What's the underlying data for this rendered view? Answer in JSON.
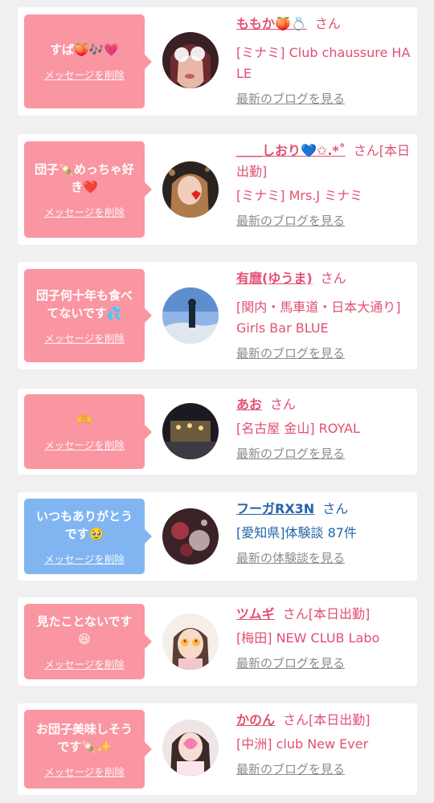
{
  "delete_label": "メッセージを削除",
  "san_label": "さん",
  "entries": [
    {
      "message": "すば🍑🎶💗",
      "name": "ももか🍑💍",
      "after_name": "",
      "shop": "[ミナミ] Club chaussure HALE",
      "link": "最新のブログを見る",
      "color": "pink"
    },
    {
      "message": "団子🍡めっちゃ好き❤️",
      "name": "＿＿しおり💙✩.*˚",
      "after_name": "[本日出勤]",
      "shop": "[ミナミ] Mrs.J ミナミ",
      "link": "最新のブログを見る",
      "color": "pink"
    },
    {
      "message": "団子何十年も食べてないです💦",
      "name": "有麿(ゆうま)",
      "after_name": "",
      "shop": "[関内・馬車道・日本大通り] Girls Bar BLUE",
      "link": "最新のブログを見る",
      "color": "pink"
    },
    {
      "message": "🫶",
      "name": "あお",
      "after_name": "",
      "shop": "[名古屋 金山] ROYAL",
      "link": "最新のブログを見る",
      "color": "pink"
    },
    {
      "message": "いつもありがとうです🥹",
      "name": "フーガRX3N",
      "after_name": "",
      "shop": "[愛知県]体験談 87件",
      "link": "最新の体験談を見る",
      "color": "blue"
    },
    {
      "message": "見たことないです😆",
      "name": "ツムギ",
      "after_name": "[本日出勤]",
      "shop": "[梅田] NEW CLUB Labo",
      "link": "最新のブログを見る",
      "color": "pink"
    },
    {
      "message": "お団子美味しそうです🍡✨",
      "name": "かのん",
      "after_name": "[本日出勤]",
      "shop": "[中洲] club New Ever",
      "link": "最新のブログを見る",
      "color": "pink"
    }
  ]
}
